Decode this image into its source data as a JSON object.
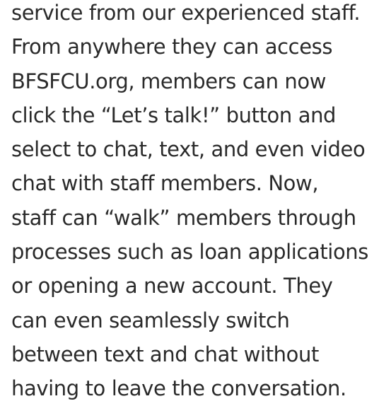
{
  "article": {
    "lines": [
      "service from our experienced staff.",
      "From anywhere they can access",
      "BFSFCU.org, members can now",
      "click the “Let’s talk!” button and",
      "select to chat, text, and even video",
      "chat with staff members. Now,",
      "staff can “walk” members through",
      "processes such as loan applications",
      "or opening a new account. They",
      "can even seamlessly switch",
      "between text and chat without",
      "having to leave the conversation."
    ]
  }
}
